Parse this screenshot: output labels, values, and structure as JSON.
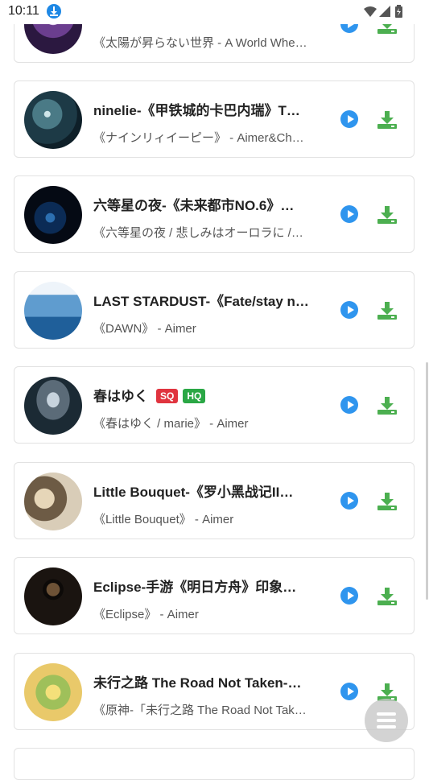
{
  "status": {
    "time": "10:11"
  },
  "colors": {
    "play": "#2f95ee",
    "download": "#4caf50",
    "badge_sq": "#e0343f",
    "badge_hq": "#2aa745"
  },
  "songs": [
    {
      "title": "",
      "subtitle": "《太陽が昇らない世界 - A World Whe…"
    },
    {
      "title": "ninelie-《甲铁城的卡巴内瑞》T…",
      "subtitle": "《ナインリィイーピー》 - Aimer&Ch…"
    },
    {
      "title": "六等星の夜-《未来都市NO.6》…",
      "subtitle": "《六等星の夜 / 悲しみはオーロラに /…"
    },
    {
      "title": "LAST STARDUST-《Fate/stay n…",
      "subtitle": "《DAWN》 - Aimer"
    },
    {
      "title": "春はゆく",
      "subtitle": "《春はゆく / marie》 - Aimer",
      "badges": [
        "SQ",
        "HQ"
      ]
    },
    {
      "title": "Little Bouquet-《罗小黑战记II…",
      "subtitle": "《Little Bouquet》 - Aimer"
    },
    {
      "title": "Eclipse-手游《明日方舟》印象…",
      "subtitle": "《Eclipse》 - Aimer"
    },
    {
      "title": "未行之路 The Road Not Taken-…",
      "subtitle": "《原神-「未行之路 The Road Not Tak…"
    }
  ]
}
